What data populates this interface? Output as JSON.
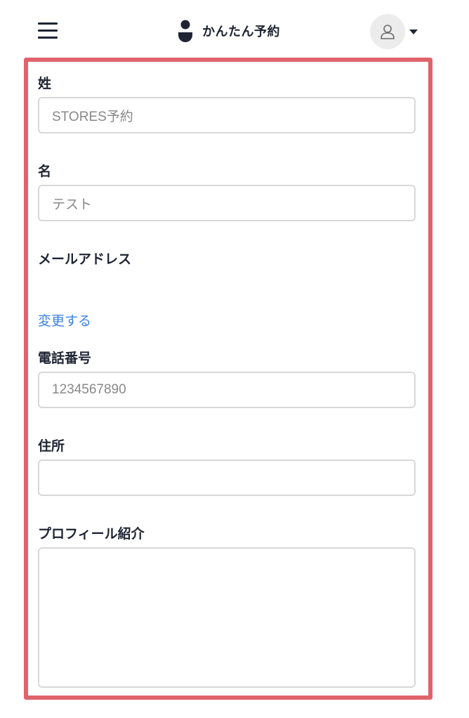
{
  "header": {
    "brand_name": "かんたん予約"
  },
  "form": {
    "last_name": {
      "label": "姓",
      "value": "STORES予約"
    },
    "first_name": {
      "label": "名",
      "value": "テスト"
    },
    "email": {
      "label": "メールアドレス",
      "change_link": "変更する"
    },
    "phone": {
      "label": "電話番号",
      "value": "1234567890"
    },
    "address": {
      "label": "住所",
      "value": ""
    },
    "profile": {
      "label": "プロフィール紹介",
      "value": ""
    }
  },
  "colors": {
    "frame": "#e0636b",
    "link": "#3b82e4",
    "text": "#1f2433"
  }
}
